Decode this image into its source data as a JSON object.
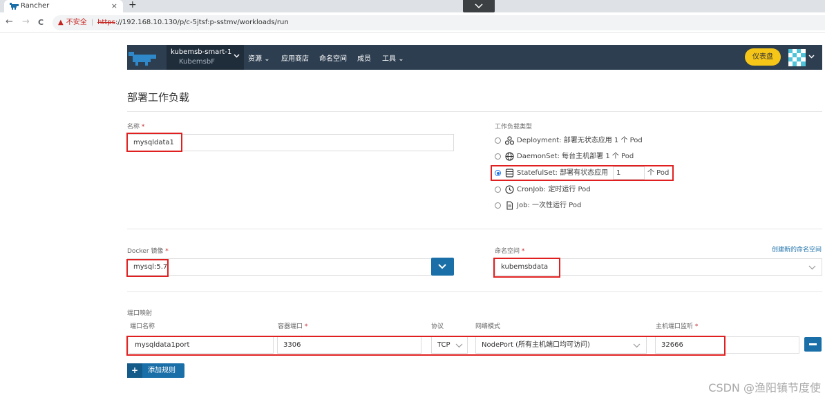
{
  "browser": {
    "tab_title": "Rancher",
    "tab_close": "×",
    "new_tab": "+",
    "nav_back": "←",
    "nav_forward": "→",
    "nav_reload": "C",
    "insecure_label": "不安全",
    "url_scheme": "https",
    "url_rest": "://192.168.10.130/p/c-5jtsf:p-sstmv/workloads/run"
  },
  "header": {
    "cluster_name": "kubemsb-smart-1",
    "cluster_sub": "KubemsbF",
    "menu": {
      "resources": "资源",
      "catalog": "应用商店",
      "namespaces": "命名空间",
      "members": "成员",
      "tools": "工具"
    },
    "dashboard": "仪表盘"
  },
  "page": {
    "title": "部署工作负载"
  },
  "form": {
    "name_label": "名称",
    "name_value": "mysqldata1",
    "workload_type_label": "工作负载类型",
    "workload_types": [
      {
        "name": "Deployment:",
        "desc": "部署无状态应用 1 个 Pod",
        "selected": false
      },
      {
        "name": "DaemonSet:",
        "desc": "每台主机部署 1 个 Pod",
        "selected": false
      },
      {
        "name": "StatefulSet:",
        "desc": "部署有状态应用",
        "count": "1",
        "suffix": "个 Pod",
        "selected": true
      },
      {
        "name": "CronJob:",
        "desc": "定时运行 Pod",
        "selected": false
      },
      {
        "name": "Job:",
        "desc": "一次性运行 Pod",
        "selected": false
      }
    ],
    "image_label": "Docker 镜像",
    "image_value": "mysql:5.7",
    "namespace_label": "命名空间",
    "namespace_value": "kubemsbdata",
    "create_namespace_link": "创建新的命名空间",
    "required_mark": "*"
  },
  "ports": {
    "section_label": "端口映射",
    "headers": {
      "port_name": "端口名称",
      "container_port": "容器端口",
      "protocol": "协议",
      "network_mode": "网络模式",
      "host_port": "主机端口监听"
    },
    "row": {
      "port_name": "mysqldata1port",
      "container_port": "3306",
      "protocol": "TCP",
      "network_mode": "NodePort (所有主机端口均可访问)",
      "host_port": "32666"
    },
    "add_rule": "添加规则",
    "add_plus": "+"
  },
  "watermark": "CSDN @渔阳镇节度使",
  "colors": {
    "header_bg": "#2d3e50",
    "accent_blue": "#1a6fa8",
    "dashboard_yellow": "#f5c518",
    "highlight_red": "#e02020"
  }
}
